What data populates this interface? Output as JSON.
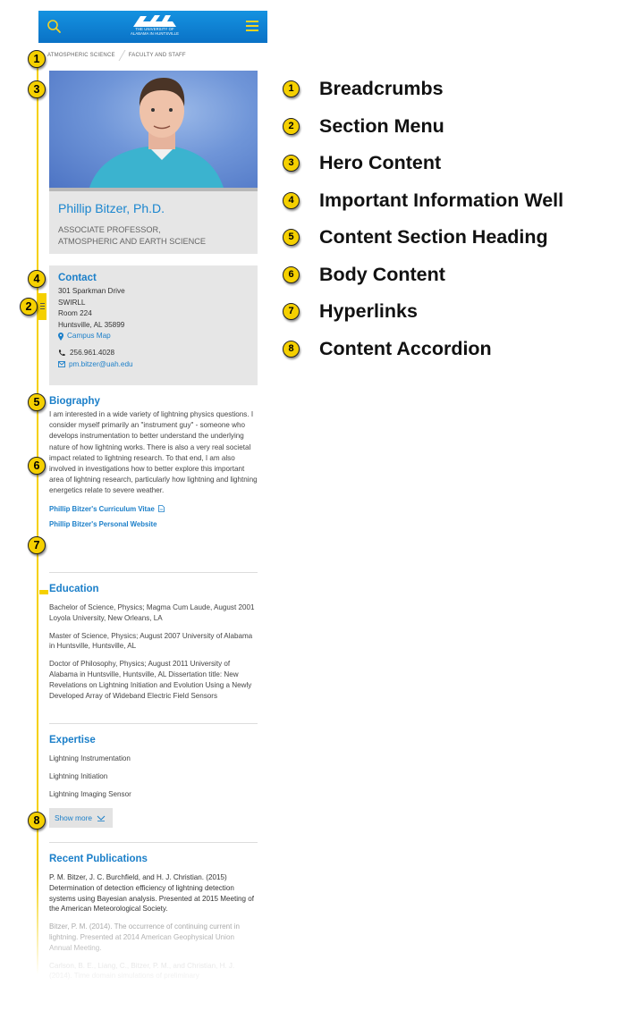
{
  "header": {
    "logo_text": "UAH",
    "logo_subtitle_line1": "THE UNIVERSITY OF",
    "logo_subtitle_line2": "ALABAMA IN HUNTSVILLE",
    "brand_color": "#0a7fd0",
    "accent_color": "#f5d321"
  },
  "breadcrumbs": [
    "ATMOSPHERIC SCIENCE",
    "FACULTY AND STAFF"
  ],
  "hero": {
    "name": "Phillip Bitzer, Ph.D.",
    "title_line1": "ASSOCIATE PROFESSOR,",
    "title_line2": "ATMOSPHERIC AND EARTH SCIENCE"
  },
  "contact": {
    "heading": "Contact",
    "address": [
      "301 Sparkman Drive",
      "SWIRLL",
      "Room 224",
      "Huntsville, AL 35899"
    ],
    "map_link": "Campus Map",
    "phone": "256.961.4028",
    "email": "pm.bitzer@uah.edu"
  },
  "biography": {
    "heading": "Biography",
    "text": "I am interested in a wide variety of lightning physics questions. I consider myself primarily an \"instrument guy\" - someone who develops instrumentation to better understand the underlying nature of how lightning works. There is also a very real societal impact related to lightning research. To that end, I am also involved in investigations how to better explore this important area of lightning research, particularly how lightning and lightning energetics relate to severe weather.",
    "links": [
      "Phillip Bitzer's Curriculum Vitae",
      "Phillip Bitzer's Personal Website"
    ]
  },
  "education": {
    "heading": "Education",
    "items": [
      "Bachelor of Science, Physics; Magma Cum Laude, August 2001 Loyola University, New Orleans, LA",
      "Master of Science, Physics; August 2007 University of Alabama in Huntsville, Huntsville, AL",
      "Doctor of Philosophy, Physics; August 2011 University of Alabama in Huntsville, Huntsville, AL Dissertation title: New Revelations on Lightning Initiation and Evolution Using a Newly Developed Array of Wideband Electric Field Sensors"
    ]
  },
  "expertise": {
    "heading": "Expertise",
    "items": [
      "Lightning Instrumentation",
      "Lightning Initiation",
      "Lightning Imaging Sensor"
    ],
    "show_more": "Show more"
  },
  "publications": {
    "heading": "Recent Publications",
    "items": [
      "P. M. Bitzer, J. C. Burchfield, and H. J. Christian. (2015) Determination of detection efficiency of lightning detection systems using Bayesian analysis. Presented at 2015 Meeting of the American Meteorological Society.",
      "Bitzer, P. M. (2014). The occurrence of continuing current in lightning. Presented at 2014 American Geophysical Union Annual Meeting.",
      "Carlson, B. E., Liang, C., Bitzer, P. M., and Christian, H. J. (2014). Time domain simulations of preliminary"
    ]
  },
  "annotations": {
    "badges": [
      "1",
      "2",
      "3",
      "4",
      "5",
      "6",
      "7",
      "8"
    ],
    "legend": [
      {
        "num": "1",
        "label": "Breadcrumbs"
      },
      {
        "num": "2",
        "label": "Section Menu"
      },
      {
        "num": "3",
        "label": "Hero Content"
      },
      {
        "num": "4",
        "label": "Important Information Well"
      },
      {
        "num": "5",
        "label": "Content Section Heading"
      },
      {
        "num": "6",
        "label": "Body Content"
      },
      {
        "num": "7",
        "label": "Hyperlinks"
      },
      {
        "num": "8",
        "label": "Content Accordion"
      }
    ],
    "badge_color": "#f5d000"
  }
}
